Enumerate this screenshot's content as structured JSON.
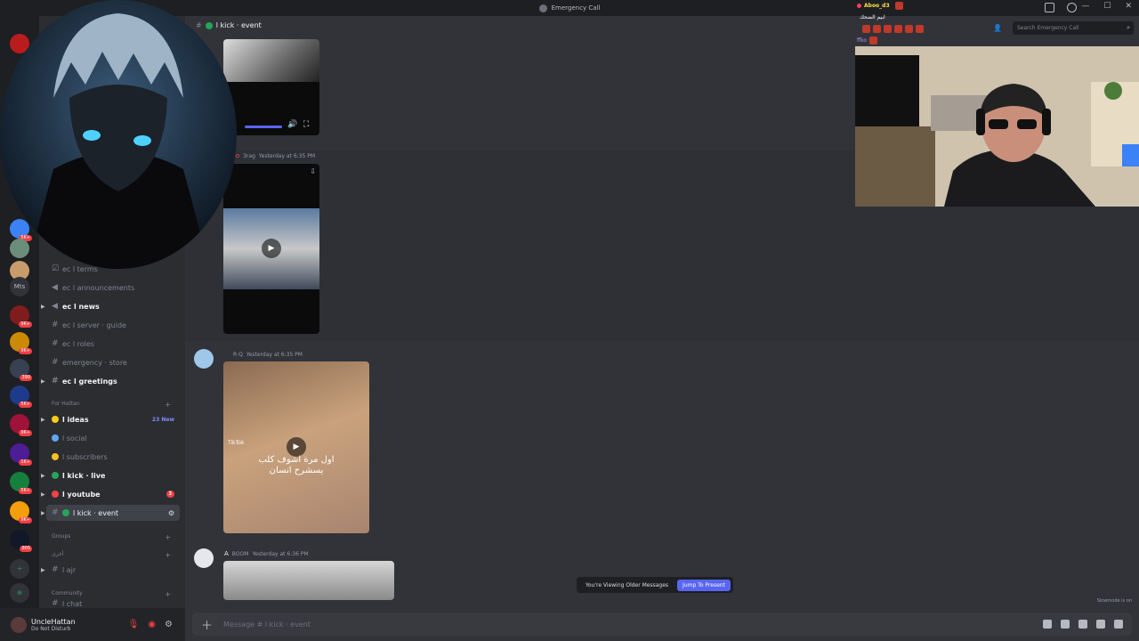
{
  "window": {
    "title": "Emergency Call"
  },
  "rail": {
    "badges": [
      "99+",
      "5K+",
      "9K+",
      "9K+",
      "9K+",
      "390",
      "5K+",
      "9K+",
      "1K+",
      "5K+",
      "9K+",
      "5K+",
      "905"
    ],
    "text_server": "Mts"
  },
  "sidebar": {
    "channels": [
      {
        "name": "ec l terms"
      },
      {
        "name": "ec l announcements"
      },
      {
        "name": "ec l news"
      },
      {
        "name": "ec l server · guide"
      },
      {
        "name": "ec l roles"
      },
      {
        "name": "emergency · store"
      },
      {
        "name": "ec l greetings"
      }
    ],
    "category_hattan": "For Hattan",
    "hattan_channels": [
      {
        "name": "l ideas",
        "extra": "23 New"
      },
      {
        "name": "l social"
      },
      {
        "name": "l subscribers"
      },
      {
        "name": "l kick · live"
      },
      {
        "name": "l youtube",
        "badge": "3"
      },
      {
        "name": "l kick · event"
      }
    ],
    "category_groups": "Groups",
    "category_other": "أخرى",
    "other_channels": [
      {
        "name": "l ajr"
      }
    ],
    "category_community": "Community",
    "community_channels": [
      {
        "name": "l chat"
      }
    ]
  },
  "user": {
    "name": "UncleHattan",
    "status": "Do Not Disturb"
  },
  "chat": {
    "channel_name": "l kick · event",
    "messages": [
      {
        "user": "mo",
        "tag": "3rag",
        "time": "Yesterday at 6:35 PM"
      },
      {
        "user": "",
        "tag": "R·Q",
        "time": "Yesterday at 6:35 PM",
        "overlay_text_1": "اول مرة اشوف كلب",
        "overlay_text_2": "يسشرح انسان",
        "watermark": "TikTok"
      },
      {
        "user": "A",
        "tag": "BOOM",
        "time": "Yesterday at 6:36 PM"
      }
    ],
    "older_notice": "You're Viewing Older Messages",
    "jump_label": "Jump To Present",
    "slowmode": "Slowmode is on",
    "composer_placeholder": "Message # l kick · event"
  },
  "header": {
    "search_placeholder": "Search Emergency Call"
  },
  "stream_chat": [
    {
      "user": "Aboo_d3",
      "text": ""
    },
    {
      "user": "",
      "text": "ابيم الضحك"
    },
    {
      "user": "",
      "text": ""
    },
    {
      "user": "ffko",
      "text": ""
    }
  ],
  "colors": {
    "accent": "#5865f2",
    "online": "#23a55a",
    "danger": "#f23f43"
  }
}
